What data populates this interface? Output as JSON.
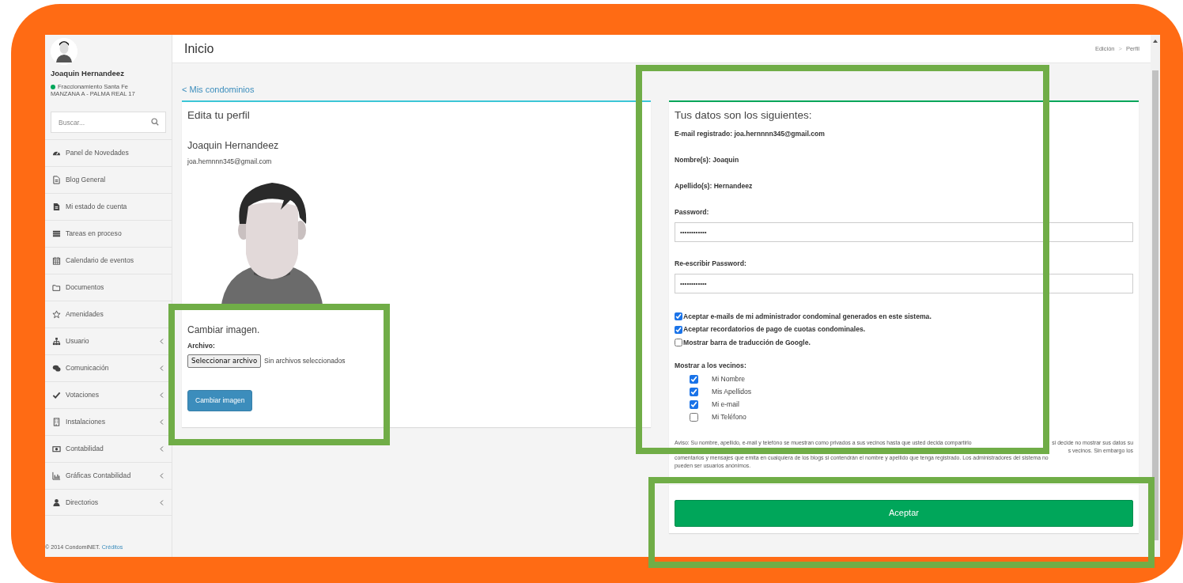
{
  "sidebar": {
    "user": {
      "name": "Joaquin Hernandeez",
      "online": true,
      "community": "Fraccionamiento Santa Fe",
      "unit": "MANZANA A - PALMA REAL 17"
    },
    "search": {
      "placeholder": "Buscar..."
    },
    "menu": [
      {
        "label": "Panel de Novedades",
        "has_submenu": false
      },
      {
        "label": "Blog General",
        "has_submenu": false
      },
      {
        "label": "Mi estado de cuenta",
        "has_submenu": false
      },
      {
        "label": "Tareas en proceso",
        "has_submenu": false
      },
      {
        "label": "Calendario de eventos",
        "has_submenu": false
      },
      {
        "label": "Documentos",
        "has_submenu": false
      },
      {
        "label": "Amenidades",
        "has_submenu": false
      },
      {
        "label": "Usuario",
        "has_submenu": true
      },
      {
        "label": "Comunicación",
        "has_submenu": true
      },
      {
        "label": "Votaciones",
        "has_submenu": true
      },
      {
        "label": "Instalaciones",
        "has_submenu": true
      },
      {
        "label": "Contabilidad",
        "has_submenu": true
      },
      {
        "label": "Gráficas Contabilidad",
        "has_submenu": true
      },
      {
        "label": "Directorios",
        "has_submenu": true
      }
    ],
    "footer": {
      "text": "© 2014 CondomiNET.",
      "link": "Créditos"
    }
  },
  "header": {
    "title": "Inicio",
    "breadcrumb": [
      "Edición",
      "Perfil"
    ],
    "separator": ">"
  },
  "back_link": "< Mis condominios",
  "profile_card": {
    "title": "Edita tu perfil",
    "name": "Joaquin Hernandeez",
    "email": "joa.hernnnn345@gmail.com",
    "change_image": {
      "title": "Cambiar imagen.",
      "file_label": "Archivo:",
      "file_button": "Seleccionar archivo",
      "file_status": "Sin archivos seleccionados",
      "submit": "Cambiar imagen"
    }
  },
  "data_card": {
    "title": "Tus datos son los siguientes:",
    "facts": [
      "E-mail registrado: joa.hernnnn345@gmail.com",
      "Nombre(s): Joaquin",
      "Apellido(s): Hernandeez"
    ],
    "password_fields": [
      {
        "label": "Password:",
        "value": "••••••••••••"
      },
      {
        "label": "Re-escribir Password:",
        "value": "••••••••••••"
      }
    ],
    "options": [
      {
        "label": "Aceptar e-mails de mi administrador condominal generados en este sistema.",
        "checked": true
      },
      {
        "label": "Aceptar recordatorios de pago de cuotas condominales.",
        "checked": true
      },
      {
        "label": "Mostrar barra de traducción de Google.",
        "checked": false
      }
    ],
    "show_to_neighbors": {
      "title": "Mostrar a los vecinos:",
      "items": [
        {
          "label": "Mi Nombre",
          "checked": true
        },
        {
          "label": "Mis Apellidos",
          "checked": true
        },
        {
          "label": "Mi e-mail",
          "checked": true
        },
        {
          "label": "Mi Teléfono",
          "checked": false
        }
      ]
    },
    "notice_lines": [
      {
        "left": "Aviso: Su nombre, apellido, e-mail y telefóno se muestran como privados a sus vecinos hasta que usted decida compartirlo",
        "right": "si decide no mostrar sus datos su"
      },
      {
        "right": "s vecinos. Sin embargo los"
      },
      {
        "left": "comentarios y mensajes que emita en cualquiera de los blogs si contendrán el nombre y apellido que tenga registrado. Los administradores del sistema no"
      },
      {
        "left": "pueden ser usuarios anónimos."
      }
    ],
    "submit": "Aceptar"
  }
}
